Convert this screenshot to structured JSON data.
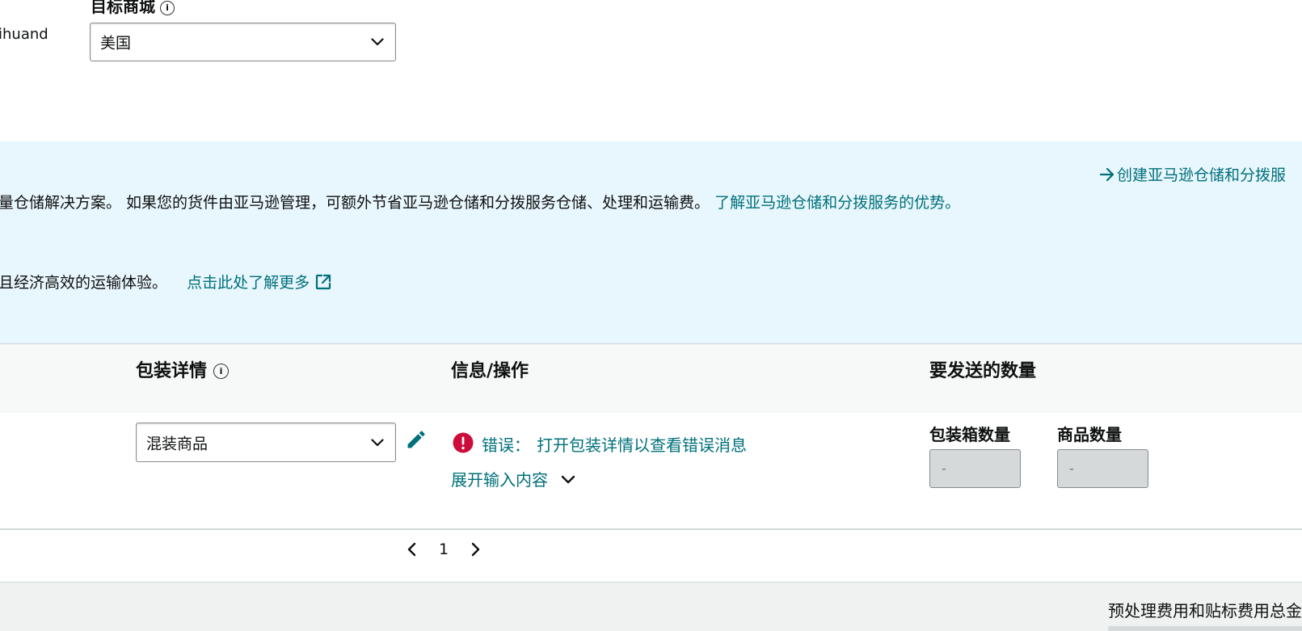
{
  "account": {
    "name_fragment": "ihuand"
  },
  "marketplace": {
    "label": "目标商城",
    "info_icon": "info-icon",
    "selected": "美国"
  },
  "banner": {
    "create_link": "创建亚马逊仓储和分拨服",
    "line1_text": "量仓储解决方案。 如果您的货件由亚马逊管理，可额外节省亚马逊仓储和分拨服务仓储、处理和运输费。",
    "line1_link": "了解亚马逊仓储和分拨服务的优势。",
    "line2_text": "且经济高效的运输体验。",
    "line2_link": "点击此处了解更多"
  },
  "table": {
    "headers": {
      "packing": "包装详情",
      "info": "信息/操作",
      "quantity": "要发送的数量"
    },
    "row": {
      "pack_type": "混装商品",
      "error_label": "错误：",
      "error_message": "打开包装详情以查看错误消息",
      "expand_label": "展开输入内容",
      "box_qty_label": "包装箱数量",
      "item_qty_label": "商品数量",
      "box_qty_placeholder": "-",
      "item_qty_placeholder": "-"
    }
  },
  "pagination": {
    "current": "1"
  },
  "footer": {
    "summary_label": "预处理费用和贴标费用总金"
  },
  "colors": {
    "link": "#00707a",
    "banner_bg": "#e8f6fd",
    "error": "#cc0c39",
    "header_bg": "#f7f8f8"
  }
}
